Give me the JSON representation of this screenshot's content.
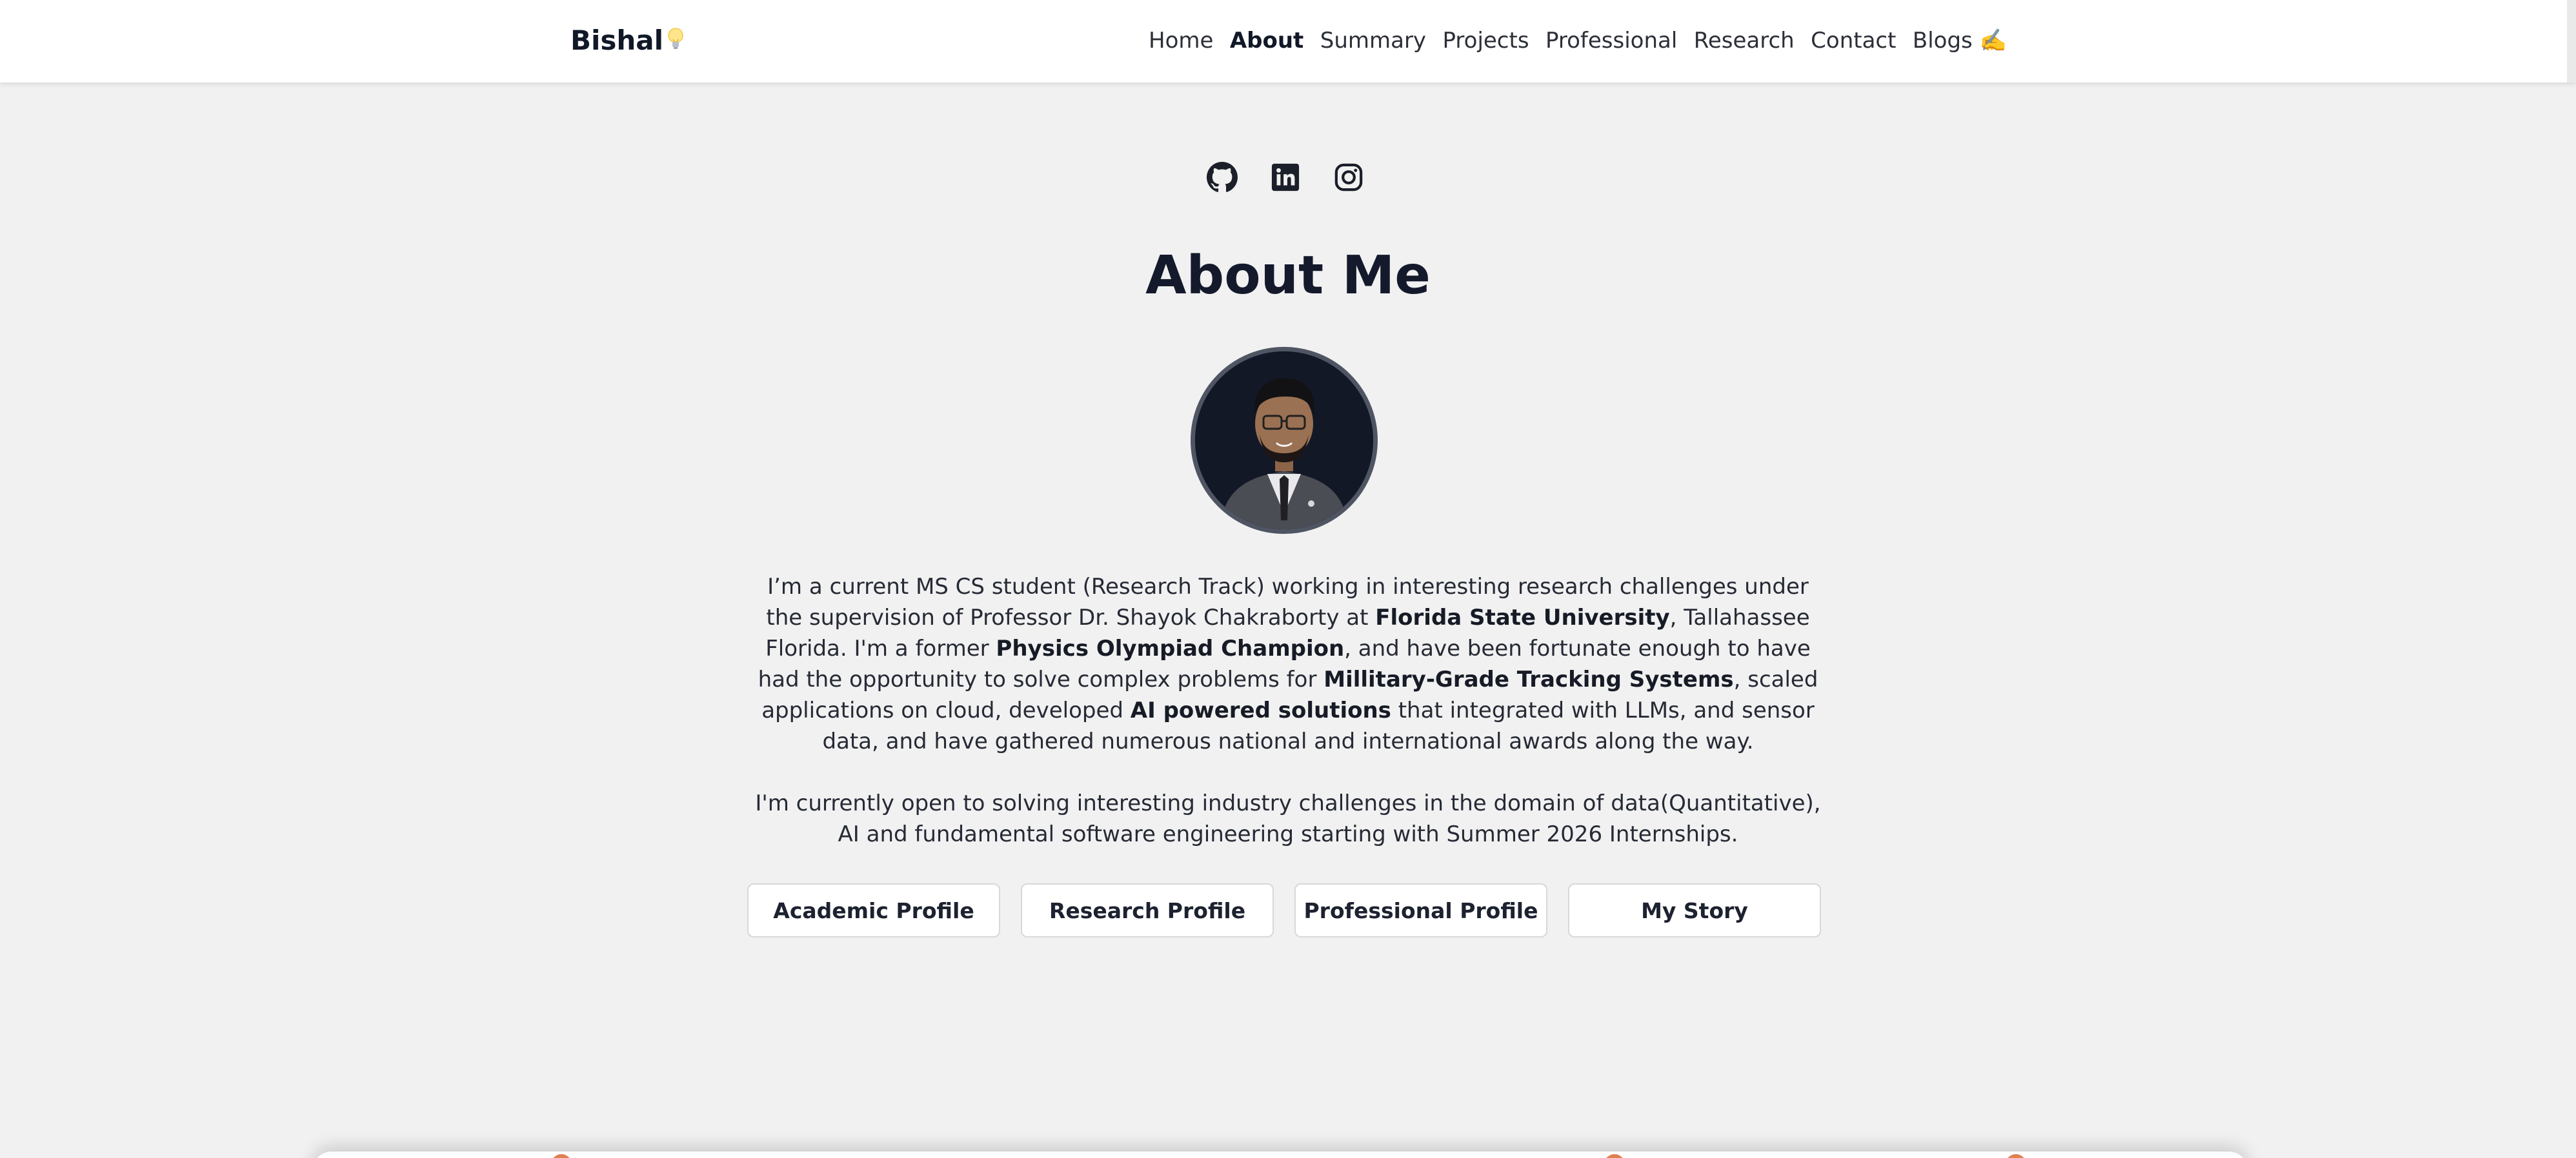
{
  "brand": {
    "name": "Bishal"
  },
  "nav": {
    "items": [
      {
        "label": "Home",
        "active": false
      },
      {
        "label": "About",
        "active": true
      },
      {
        "label": "Summary",
        "active": false
      },
      {
        "label": "Projects",
        "active": false
      },
      {
        "label": "Professional",
        "active": false
      },
      {
        "label": "Research",
        "active": false
      },
      {
        "label": "Contact",
        "active": false
      },
      {
        "label": "Blogs ✍️",
        "active": false
      }
    ]
  },
  "social": {
    "icons": [
      "github-icon",
      "linkedin-icon",
      "instagram-icon"
    ]
  },
  "about": {
    "title": "About Me",
    "p1": {
      "t1": "I’m a current MS CS student (Research Track) working in interesting research challenges under the supervision of Professor Dr. Shayok Chakraborty at ",
      "b1": "Florida State University",
      "t2": ", Tallahassee Florida. I'm a former ",
      "b2": "Physics Olympiad Champion",
      "t3": ", and have been fortunate enough to have had the opportunity to solve complex problems for ",
      "b3": "Millitary-Grade Tracking Systems",
      "t4": ", scaled applications on cloud, developed ",
      "b4": "AI powered solutions",
      "t5": " that integrated with LLMs, and sensor data, and have gathered numerous national and international awards along the way."
    },
    "p2": "I'm currently open to solving interesting industry challenges in the domain of data(Quantitative), AI and fundamental software engineering starting with Summer 2026 Internships."
  },
  "buttons": {
    "academic": "Academic Profile",
    "research": "Research Profile",
    "professional": "Professional Profile",
    "story": "My Story"
  },
  "colors": {
    "background": "#f1f1f1",
    "navbar": "#ffffff",
    "heading": "#141a2c",
    "avatar_bg": "#111827",
    "accent_dot": "#e0804f"
  }
}
